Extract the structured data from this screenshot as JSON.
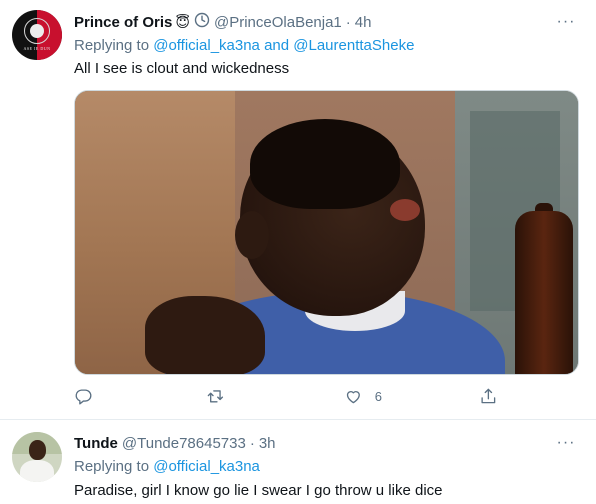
{
  "tweets": [
    {
      "name": "Prince of Oris",
      "badge_emoji": "😇",
      "handle": "@PrinceOlaBenja1",
      "separator": "·",
      "time": "4h",
      "more_label": "···",
      "replying_prefix": "Replying to ",
      "replying_to": "@official_ka3na and @LaurenttaSheke",
      "text": "All I see is clout and wickedness",
      "avatar_text": "ASE IE DUN",
      "actions": {
        "reply_count": "",
        "retweet_count": "",
        "like_count": "6"
      }
    },
    {
      "name": "Tunde",
      "handle": "@Tunde78645733",
      "separator": "·",
      "time": "3h",
      "more_label": "···",
      "replying_prefix": "Replying to ",
      "replying_to": "@official_ka3na",
      "text": "Paradise, girl I know go lie I swear I go throw u like dice"
    }
  ],
  "icons": {
    "clock": "clock-icon",
    "reply": "reply-icon",
    "retweet": "retweet-icon",
    "like": "heart-icon",
    "share": "share-icon",
    "more": "more-icon"
  },
  "colors": {
    "link": "#1b95e0",
    "secondary_text": "#5b7083",
    "primary_text": "#0f1419",
    "divider": "#e6ecf0"
  }
}
